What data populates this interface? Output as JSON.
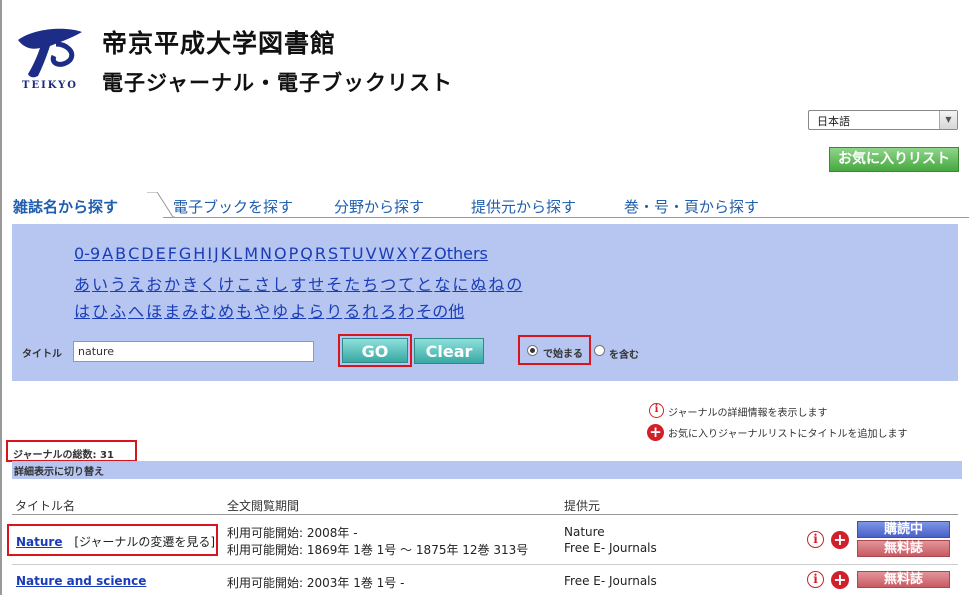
{
  "header": {
    "logo_text": "TEIKYO",
    "library_name": "帝京平成大学図書館",
    "list_name": "電子ジャーナル・電子ブックリスト"
  },
  "language": {
    "selected": "日本語"
  },
  "favorites_button": "お気に入りリスト",
  "tabs": [
    {
      "label": "雑誌名から探す",
      "active": true
    },
    {
      "label": "電子ブックを探す"
    },
    {
      "label": "分野から探す"
    },
    {
      "label": "提供元から探す"
    },
    {
      "label": "巻・号・頁から探す"
    }
  ],
  "alphabet": {
    "row1": [
      "0-9",
      "A",
      "B",
      "C",
      "D",
      "E",
      "F",
      "G",
      "H",
      "I",
      "J",
      "K",
      "L",
      "M",
      "N",
      "O",
      "P",
      "Q",
      "R",
      "S",
      "T",
      "U",
      "V",
      "W",
      "X",
      "Y",
      "Z",
      "Others"
    ],
    "row2": [
      "あ",
      "い",
      "う",
      "え",
      "お",
      "か",
      "き",
      "く",
      "け",
      "こ",
      "さ",
      "し",
      "す",
      "せ",
      "そ",
      "た",
      "ち",
      "つ",
      "て",
      "と",
      "な",
      "に",
      "ぬ",
      "ね",
      "の"
    ],
    "row3": [
      "は",
      "ひ",
      "ふ",
      "へ",
      "ほ",
      "ま",
      "み",
      "む",
      "め",
      "も",
      "や",
      "ゆ",
      "よ",
      "ら",
      "り",
      "る",
      "れ",
      "ろ",
      "わ",
      "その他"
    ]
  },
  "search": {
    "title_label": "タイトル",
    "title_value": "nature",
    "go_label": "GO",
    "clear_label": "Clear",
    "radio_starts": "で始まる",
    "radio_contains": "を含む"
  },
  "legend": {
    "info_text": "ジャーナルの詳細情報を表示します",
    "add_text": "お気に入りジャーナルリストにタイトルを追加します"
  },
  "results": {
    "total_label": "ジャーナルの総数: 31",
    "detail_toggle": "詳細表示に切り替え",
    "columns": [
      "タイトル名",
      "全文閲覧期間",
      "提供元"
    ],
    "rows": [
      {
        "title": "Nature",
        "history_link": "[ジャーナルの変遷を見る]",
        "period_lines": [
          "利用可能開始: 2008年 -",
          "利用可能開始: 1869年 1巻 1号 ～ 1875年 12巻 313号"
        ],
        "provider_lines": [
          "Nature",
          "Free E- Journals"
        ],
        "buttons": [
          "購読中",
          "無料誌"
        ]
      },
      {
        "title": "Nature and science",
        "period_lines": [
          "利用可能開始: 2003年 1巻 1号 -"
        ],
        "provider_lines": [
          "Free E- Journals"
        ],
        "buttons": [
          "無料誌"
        ]
      }
    ]
  }
}
